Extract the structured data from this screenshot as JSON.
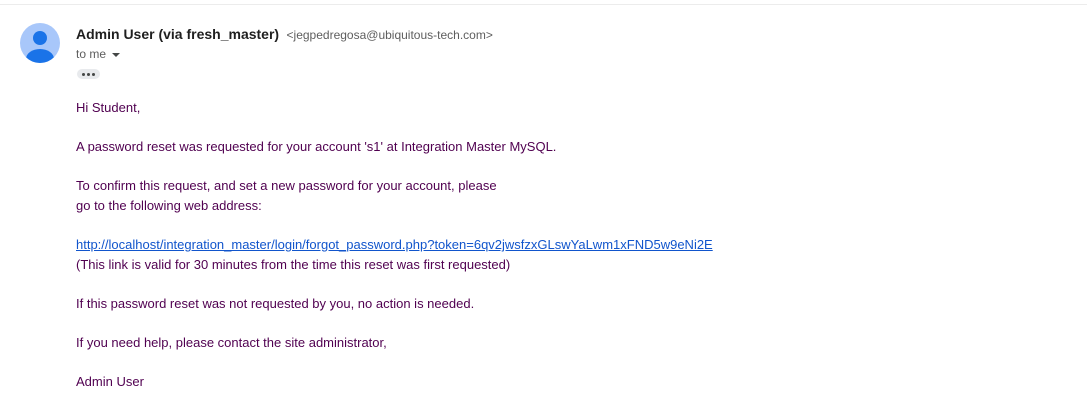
{
  "email": {
    "sender_name": "Admin User (via fresh_master)",
    "sender_email": "<jegpedregosa@ubiquitous-tech.com>",
    "recipient_label": "to me",
    "body": {
      "greeting": "Hi Student,",
      "line1": "A password reset was requested for your account 's1' at Integration Master MySQL.",
      "line2a": "To confirm this request, and set a new password for your account, please",
      "line2b": "go to the following web address:",
      "reset_link": "http://localhost/integration_master/login/forgot_password.php?token=6qv2jwsfzxGLswYaLwm1xFND5w9eNi2E",
      "link_note": "(This link is valid for 30 minutes from the time this reset was first requested)",
      "line3": "If this password reset was not requested by you, no action is needed.",
      "line4": "If you need help, please contact the site administrator,",
      "signature": "Admin User"
    }
  },
  "icons": {
    "avatar": "person-icon",
    "recipient_dropdown": "caret-down-icon",
    "trimmed_content": "ellipsis-icon"
  },
  "colors": {
    "avatar_bg": "#a8c7fa",
    "avatar_fg": "#1a73e8",
    "body_text": "#500050",
    "link": "#1155cc",
    "sender_name": "#1f1f1f",
    "secondary_text": "#5e5e5e"
  }
}
